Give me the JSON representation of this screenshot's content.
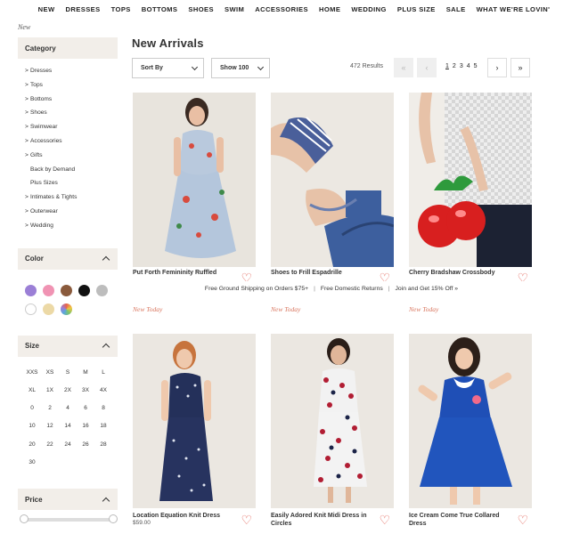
{
  "nav": [
    "NEW",
    "DRESSES",
    "TOPS",
    "BOTTOMS",
    "SHOES",
    "SWIM",
    "ACCESSORIES",
    "HOME",
    "WEDDING",
    "PLUS SIZE",
    "SALE",
    "WHAT WE'RE LOVIN'"
  ],
  "breadcrumb": "New",
  "sidebar": {
    "category_title": "Category",
    "categories": [
      {
        "label": "Dresses",
        "arrow": ">"
      },
      {
        "label": "Tops",
        "arrow": ">"
      },
      {
        "label": "Bottoms",
        "arrow": ">"
      },
      {
        "label": "Shoes",
        "arrow": ">"
      },
      {
        "label": "Swimwear",
        "arrow": ">"
      },
      {
        "label": "Accessories",
        "arrow": ">"
      },
      {
        "label": "Gifts",
        "arrow": ">"
      },
      {
        "label": "Back by Demand",
        "arrow": ""
      },
      {
        "label": "Plus Sizes",
        "arrow": ""
      },
      {
        "label": "Intimates & Tights",
        "arrow": ">"
      },
      {
        "label": "Outerwear",
        "arrow": ">"
      },
      {
        "label": "Wedding",
        "arrow": ">"
      }
    ],
    "color_title": "Color",
    "colors": [
      "#9b7fd6",
      "#f093b3",
      "#8a5a3c",
      "#111111",
      "#bdbdbd",
      "#ffffff",
      "#ecd9a6",
      "multi"
    ],
    "size_title": "Size",
    "sizes": [
      "XXS",
      "XS",
      "S",
      "M",
      "L",
      "XL",
      "1X",
      "2X",
      "3X",
      "4X",
      "0",
      "2",
      "4",
      "6",
      "8",
      "10",
      "12",
      "14",
      "16",
      "18",
      "20",
      "22",
      "24",
      "26",
      "28",
      "30"
    ],
    "price_title": "Price"
  },
  "main": {
    "title": "New Arrivals",
    "sort_label": "Sort By",
    "show_label": "Show 100",
    "results": "472 Results",
    "pages": [
      "1",
      "2",
      "3",
      "4",
      "5"
    ],
    "first_icon": "double-chevron-left-icon",
    "prev_icon": "chevron-left-icon",
    "next_icon": "chevron-right-icon",
    "last_icon": "double-chevron-right-icon"
  },
  "shipping_bar": {
    "a": "Free Ground Shipping on Orders $75+",
    "b": "Free Domestic Returns",
    "c": "Join and Get 15% Off »"
  },
  "products": [
    {
      "name": "Put Forth Femininity Ruffled",
      "price": "",
      "tag": "New Today"
    },
    {
      "name": "Shoes to Frill Espadrille",
      "price": "",
      "tag": "New Today"
    },
    {
      "name": "Cherry Bradshaw Crossbody",
      "price": "",
      "tag": "New Today"
    },
    {
      "name": "Location Equation Knit Dress",
      "price": "$59.00",
      "tag": ""
    },
    {
      "name": "Easily Adored Knit Midi Dress in Circles",
      "price": "",
      "tag": ""
    },
    {
      "name": "Ice Cream Come True Collared Dress",
      "price": "",
      "tag": ""
    }
  ],
  "accent_color": "#e05a4e"
}
